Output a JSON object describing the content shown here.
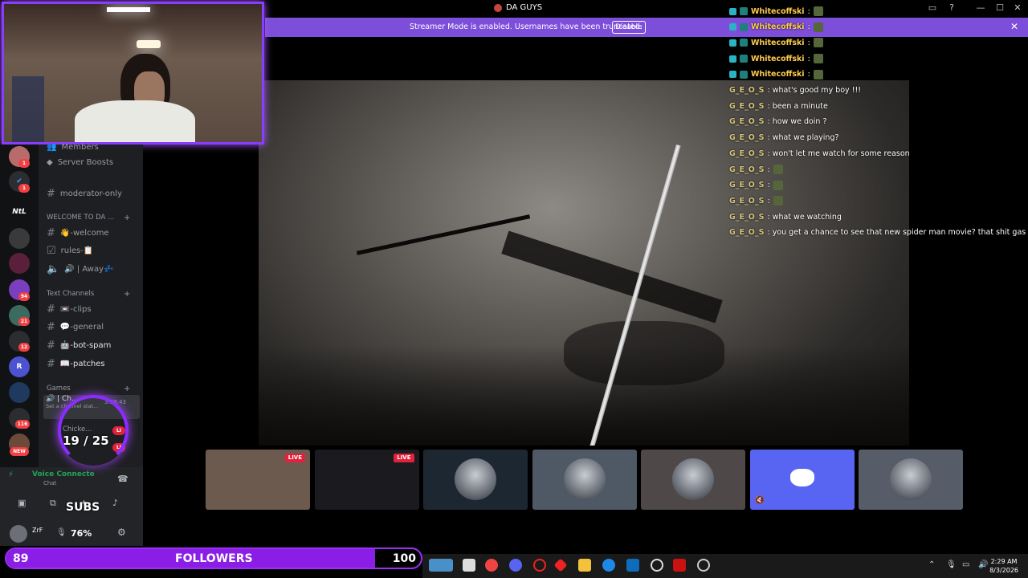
{
  "window": {
    "title": "DA GUYS",
    "controls": [
      "inbox-icon",
      "help-icon",
      "minimize",
      "maximize",
      "close"
    ]
  },
  "banner": {
    "message": "Streamer Mode is enabled. Usernames have been truncated.",
    "disable_label": "Disable",
    "color": "#7c4ed9"
  },
  "sidebar": {
    "server_badges": [
      "1",
      "1",
      "94",
      "21",
      "12",
      "116",
      "NEW"
    ],
    "server_label": "NtL",
    "channels": {
      "members_label": "Members",
      "server_boosts_label": "Server Boosts",
      "moderator_only": "moderator-only",
      "welcome_category": "WELCOME TO DA ...",
      "welcome": "👋-welcome",
      "rules": "rules-📋",
      "away": "🔊 | Away💤",
      "text_category": "Text Channels",
      "clips": "📼-clips",
      "general": "💬-general",
      "bot_spam": "🤖-bot-spam",
      "patches": "📖-patches",
      "games_category": "Games",
      "voice_channel": "🔊 | Ch...",
      "voice_status": "Set a channel stat...",
      "voice_timer": "3:38:43",
      "voice_user": "Chicke...",
      "live_badge": "LI"
    },
    "voice_panel": {
      "status": "Voice Connecte",
      "sub_status": "Chat",
      "username": "ZrF",
      "volume": "76%"
    }
  },
  "overlay": {
    "subs_label": "SUBS",
    "subs_count": "19 / 25",
    "subs_current": 19,
    "subs_goal": 25
  },
  "chat": {
    "messages": [
      {
        "user": "Whitecoffski",
        "text": ":",
        "badges": true,
        "emote": true,
        "color": "#ffcc4d"
      },
      {
        "user": "Whitecoffski",
        "text": ":",
        "badges": true,
        "emote": true,
        "color": "#ffcc4d"
      },
      {
        "user": "Whitecoffski",
        "text": ":",
        "badges": true,
        "emote": true,
        "color": "#ffcc4d"
      },
      {
        "user": "Whitecoffski",
        "text": ":",
        "badges": true,
        "emote": true,
        "color": "#ffcc4d"
      },
      {
        "user": "Whitecoffski",
        "text": ":",
        "badges": true,
        "emote": true,
        "color": "#ffcc4d"
      },
      {
        "user": "G_E_O_S",
        "text": ": what's good my boy !!!",
        "badges": false,
        "emote": false,
        "color": "#d4c47f"
      },
      {
        "user": "G_E_O_S",
        "text": ": been a minute",
        "badges": false,
        "emote": false,
        "color": "#d4c47f"
      },
      {
        "user": "G_E_O_S",
        "text": ": how we doin ?",
        "badges": false,
        "emote": false,
        "color": "#d4c47f"
      },
      {
        "user": "G_E_O_S",
        "text": ": what we playing?",
        "badges": false,
        "emote": false,
        "color": "#d4c47f"
      },
      {
        "user": "G_E_O_S",
        "text": ": won't let me watch for some reason",
        "badges": false,
        "emote": false,
        "color": "#d4c47f"
      },
      {
        "user": "G_E_O_S",
        "text": ":",
        "badges": false,
        "emote": true,
        "color": "#d4c47f"
      },
      {
        "user": "G_E_O_S",
        "text": ":",
        "badges": false,
        "emote": true,
        "color": "#d4c47f"
      },
      {
        "user": "G_E_O_S",
        "text": ":",
        "badges": false,
        "emote": true,
        "color": "#d4c47f"
      },
      {
        "user": "G_E_O_S",
        "text": ": what we watching",
        "badges": false,
        "emote": false,
        "color": "#d4c47f"
      },
      {
        "user": "G_E_O_S",
        "text": ": you get a chance to see that new spider man movie? that shit gas",
        "badges": false,
        "emote": false,
        "color": "#d4c47f"
      }
    ]
  },
  "thumbnails": [
    {
      "name": "stream-tile-1",
      "live": "LIVE",
      "bg": "#6b5a4d"
    },
    {
      "name": "stream-tile-2",
      "live": "LIVE",
      "bg": "#1a1a1f"
    },
    {
      "name": "user-tile-1",
      "live": "",
      "bg": "#1d2732"
    },
    {
      "name": "user-tile-2",
      "live": "",
      "bg": "#4e5965"
    },
    {
      "name": "user-tile-3",
      "live": "",
      "bg": "#4f4848"
    },
    {
      "name": "user-tile-discord",
      "live": "",
      "bg": "#5865f2"
    },
    {
      "name": "user-tile-4",
      "live": "",
      "bg": "#565c68"
    }
  ],
  "followers": {
    "current": "89",
    "label": "FOLLOWERS",
    "goal": "100",
    "progress": 0.89
  },
  "taskbar": {
    "time": "2:29 AM",
    "date": "8/3/2026"
  }
}
